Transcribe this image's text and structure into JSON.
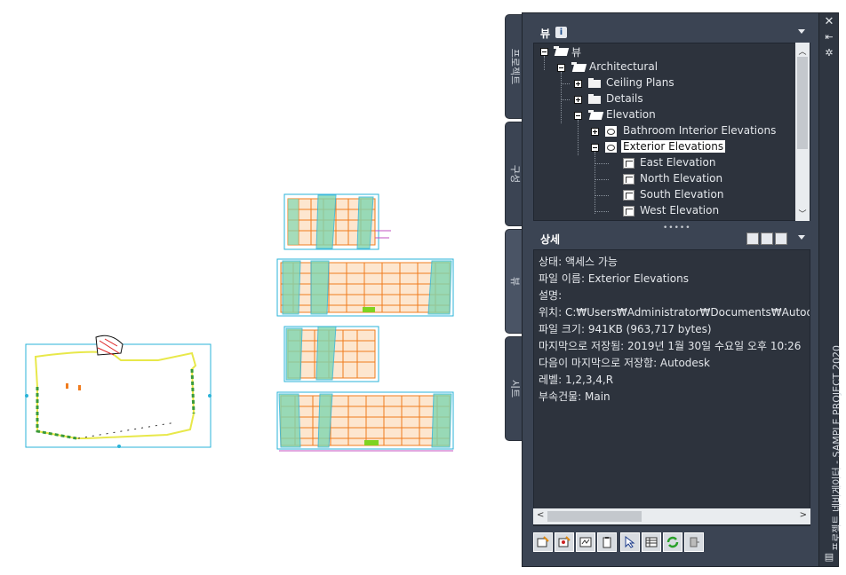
{
  "palette": {
    "title": "프로젝트 네비게이터 - SAMPLE PROJECT 2020",
    "side_tabs": [
      "프로젝트",
      "구성",
      "뷰",
      "시트"
    ],
    "view_header": "뷰",
    "detail_header": "상세"
  },
  "tree": {
    "root": "뷰",
    "architectural": "Architectural",
    "ceiling_plans": "Ceiling Plans",
    "details": "Details",
    "elevation": "Elevation",
    "bathroom": "Bathroom Interior Elevations",
    "exterior": "Exterior Elevations",
    "east": "East Elevation",
    "north": "North Elevation",
    "south": "South Elevation",
    "west": "West Elevation"
  },
  "detail": {
    "status": "상태: 액세스 가능",
    "filename": "파일 이름: Exterior Elevations",
    "description": "설명:",
    "location": "위치: C:₩Users₩Administrator₩Documents₩Autodesk₩L",
    "filesize": "파일 크기: 941KB (963,717 bytes)",
    "last_saved": "마지막으로 저장됨: 2019년 1월 30일 수요일  오후 10:26",
    "saved_by": "다음이 마지막으로 저장함: Autodesk",
    "levels": "레벨: 1,2,3,4,R",
    "building": "부속건물: Main"
  },
  "colors": {
    "panel_bg": "#3b4453",
    "tree_bg": "#2d333d",
    "drawing_orange": "#f07c1e",
    "drawing_cyan": "#2ab3d8",
    "drawing_green": "#7fd7b0"
  }
}
